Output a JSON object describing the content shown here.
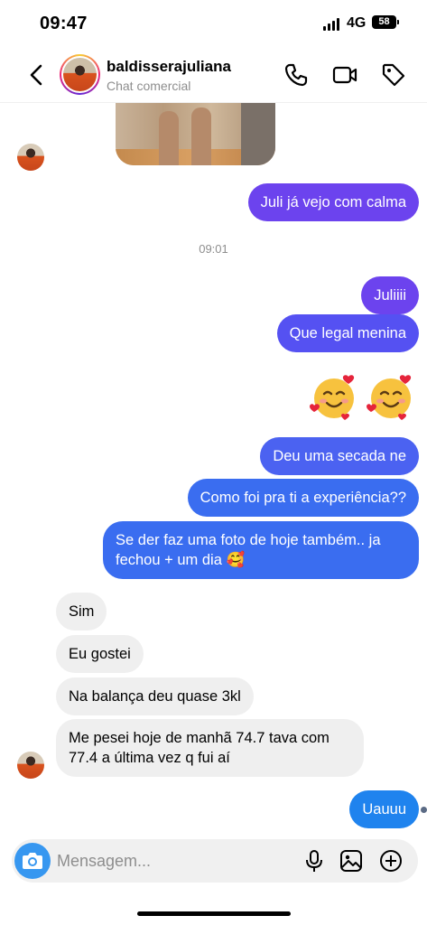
{
  "status_bar": {
    "time": "09:47",
    "network": "4G",
    "battery": "58"
  },
  "header": {
    "contact_name": "baldisserajuliana",
    "contact_subtitle": "Chat comercial",
    "icons": [
      "back-chevron-icon",
      "phone-icon",
      "video-camera-icon",
      "tag-icon"
    ]
  },
  "messages": {
    "m1": "Juli já vejo com calma",
    "timestamp": "09:01",
    "m2": "Juliiii",
    "m3": "Que legal menina",
    "emoji_pair": [
      "🥰",
      "🥰"
    ],
    "m4": "Deu uma secada ne",
    "m5": "Como foi pra ti a experiência??",
    "m6_line1": "Se der faz uma foto de hoje também.. ja",
    "m6_line2": "fechou + um dia 🥰",
    "r1": "Sim",
    "r2": "Eu gostei",
    "r3": "Na balança deu quase 3kl",
    "r4_line1": "Me pesei hoje de manhã 74.7 tava com",
    "r4_line2": "77.4 a última vez q fui aí",
    "m7": "Uauuu"
  },
  "composer": {
    "placeholder": "Mensagem...",
    "icons": [
      "camera-icon",
      "microphone-icon",
      "image-icon",
      "plus-circle-icon"
    ]
  },
  "colors": {
    "outgoing_violet": "#6c43ee",
    "outgoing_indigo": "#5551f2",
    "outgoing_blue": "#3a6df0",
    "outgoing_azure": "#1f83ee",
    "incoming": "#efefef",
    "camera_button": "#3797f0"
  }
}
